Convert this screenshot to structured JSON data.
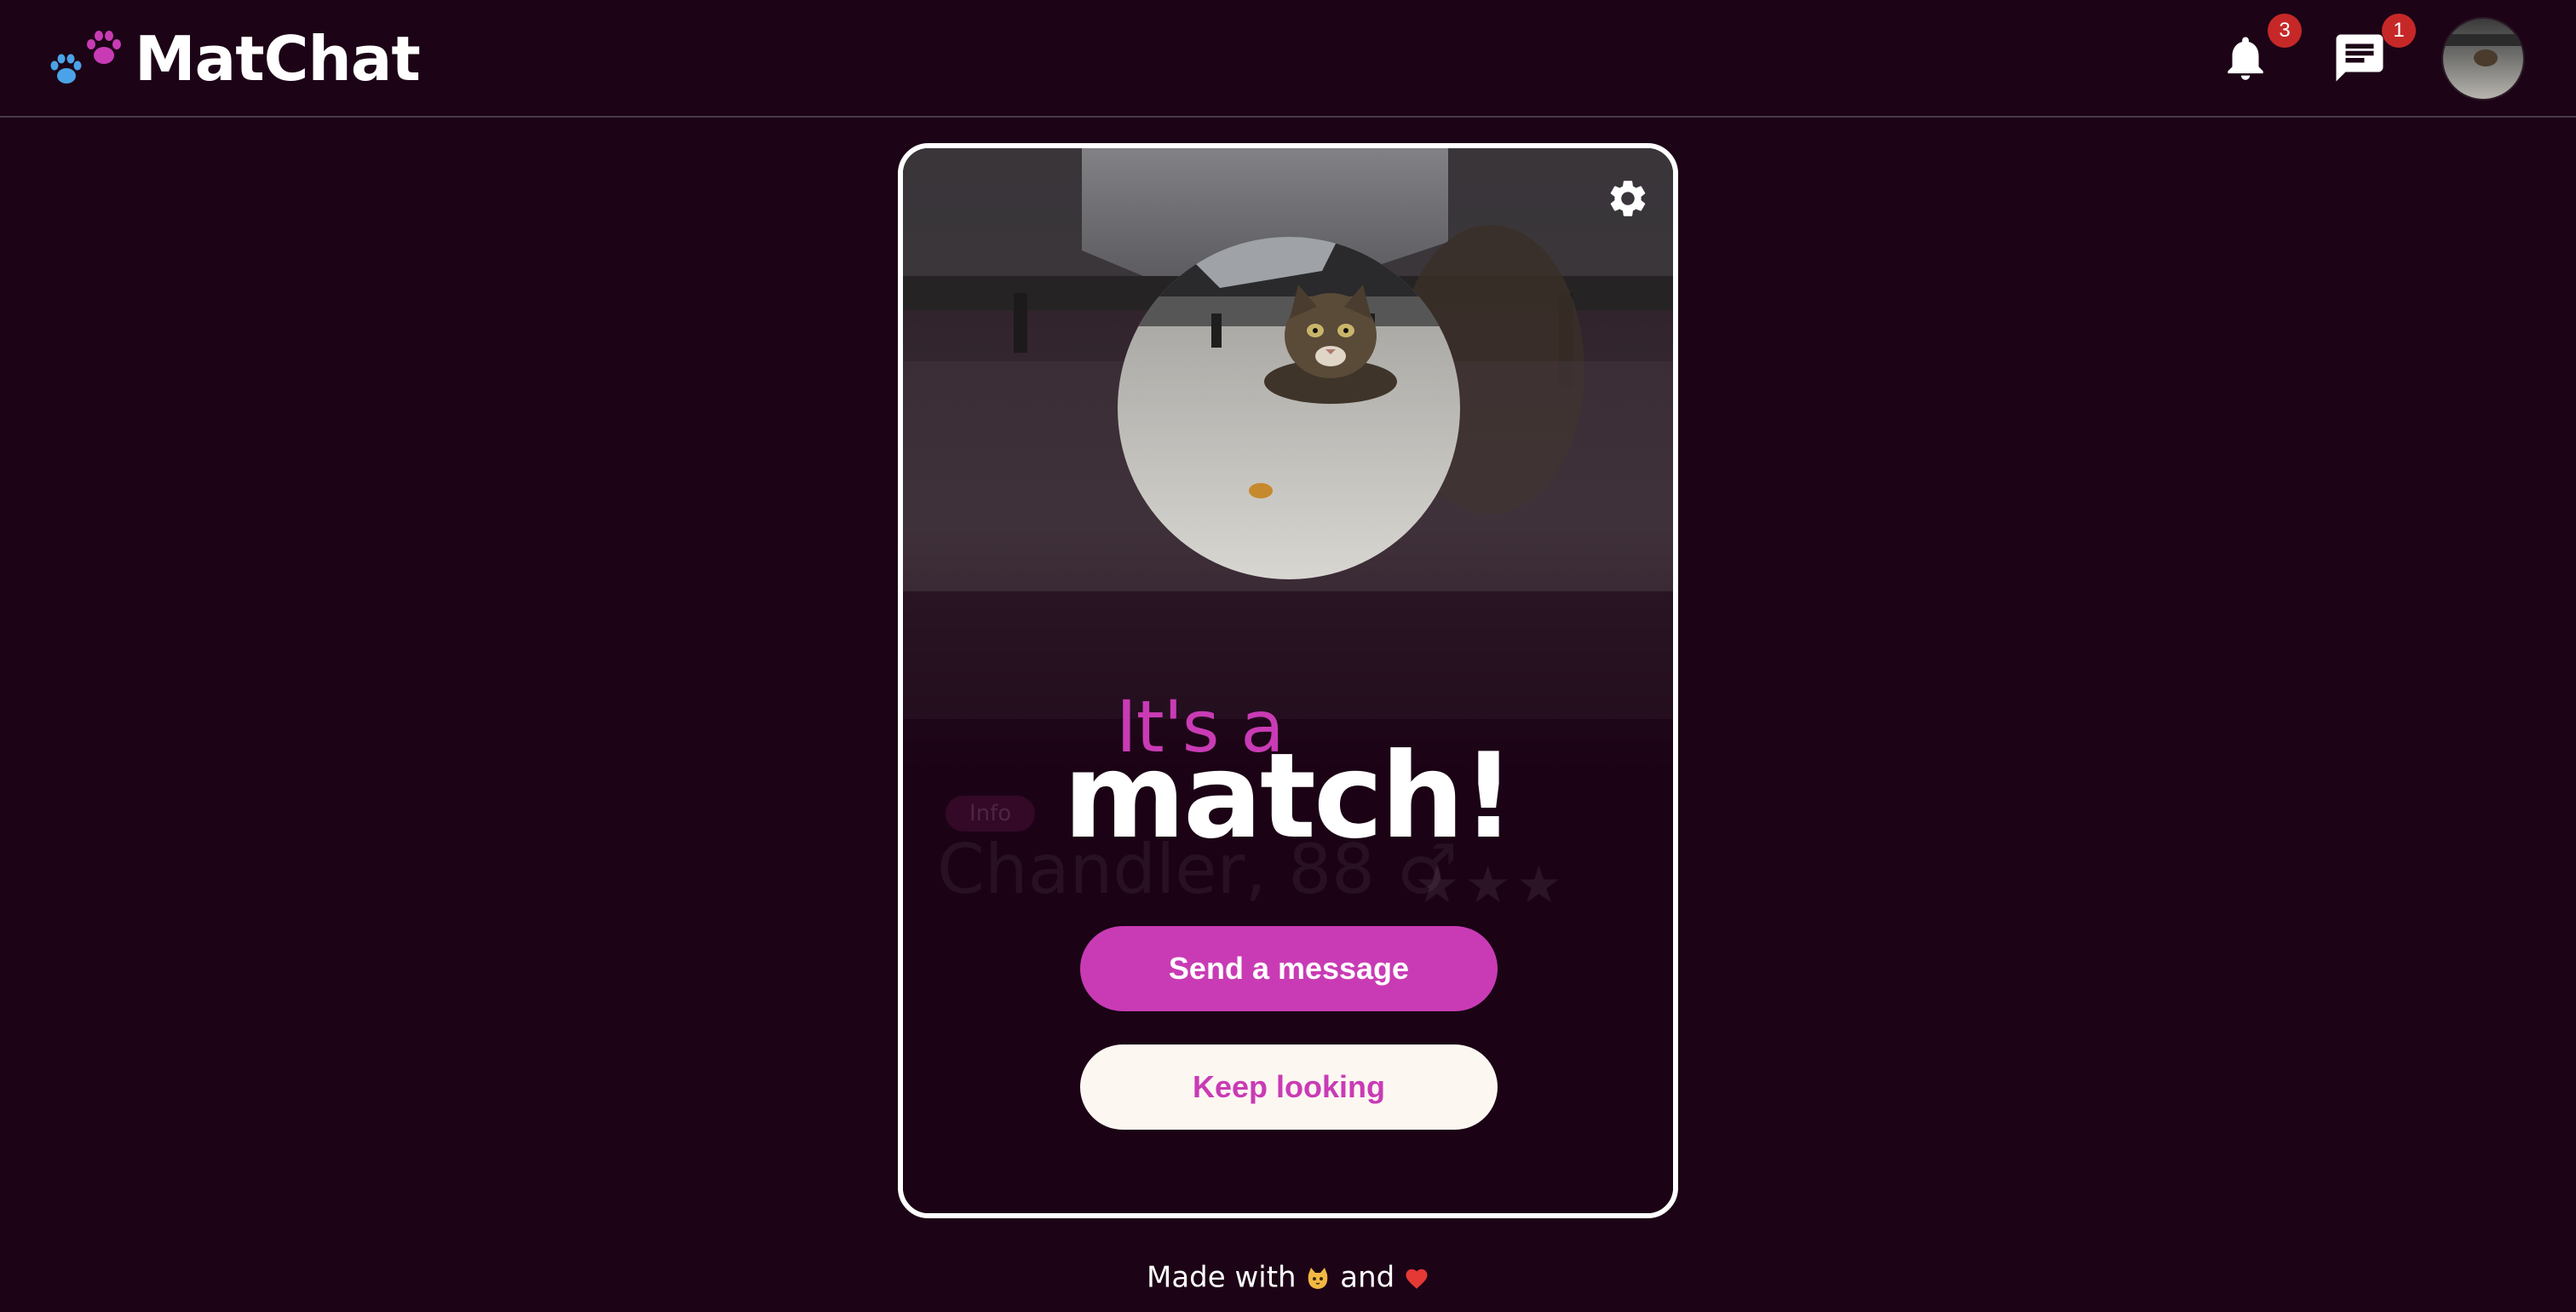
{
  "app": {
    "name": "MatChat",
    "logo_icon": "paw-prints-icon",
    "colors": {
      "background": "#1c0416",
      "accent": "#c93bb5",
      "badge": "#c62828",
      "paw_blue": "#4aa3e8"
    }
  },
  "header": {
    "notifications": {
      "icon": "bell-icon",
      "count": "3"
    },
    "messages": {
      "icon": "chat-icon",
      "count": "1"
    },
    "avatar": {
      "icon": "user-avatar"
    }
  },
  "match_card": {
    "settings_icon": "gear-icon",
    "headline_small": "It's a",
    "headline_big": "match!",
    "primary_button": "Send a message",
    "secondary_button": "Keep looking",
    "background_profile": {
      "info_label": "Info",
      "name": "Chandler, 88 ♂",
      "stars": "★★★"
    }
  },
  "footer": {
    "text_before": "Made with",
    "text_middle": "and",
    "emoji_1": "cat-face-icon",
    "emoji_2": "heart-icon"
  }
}
